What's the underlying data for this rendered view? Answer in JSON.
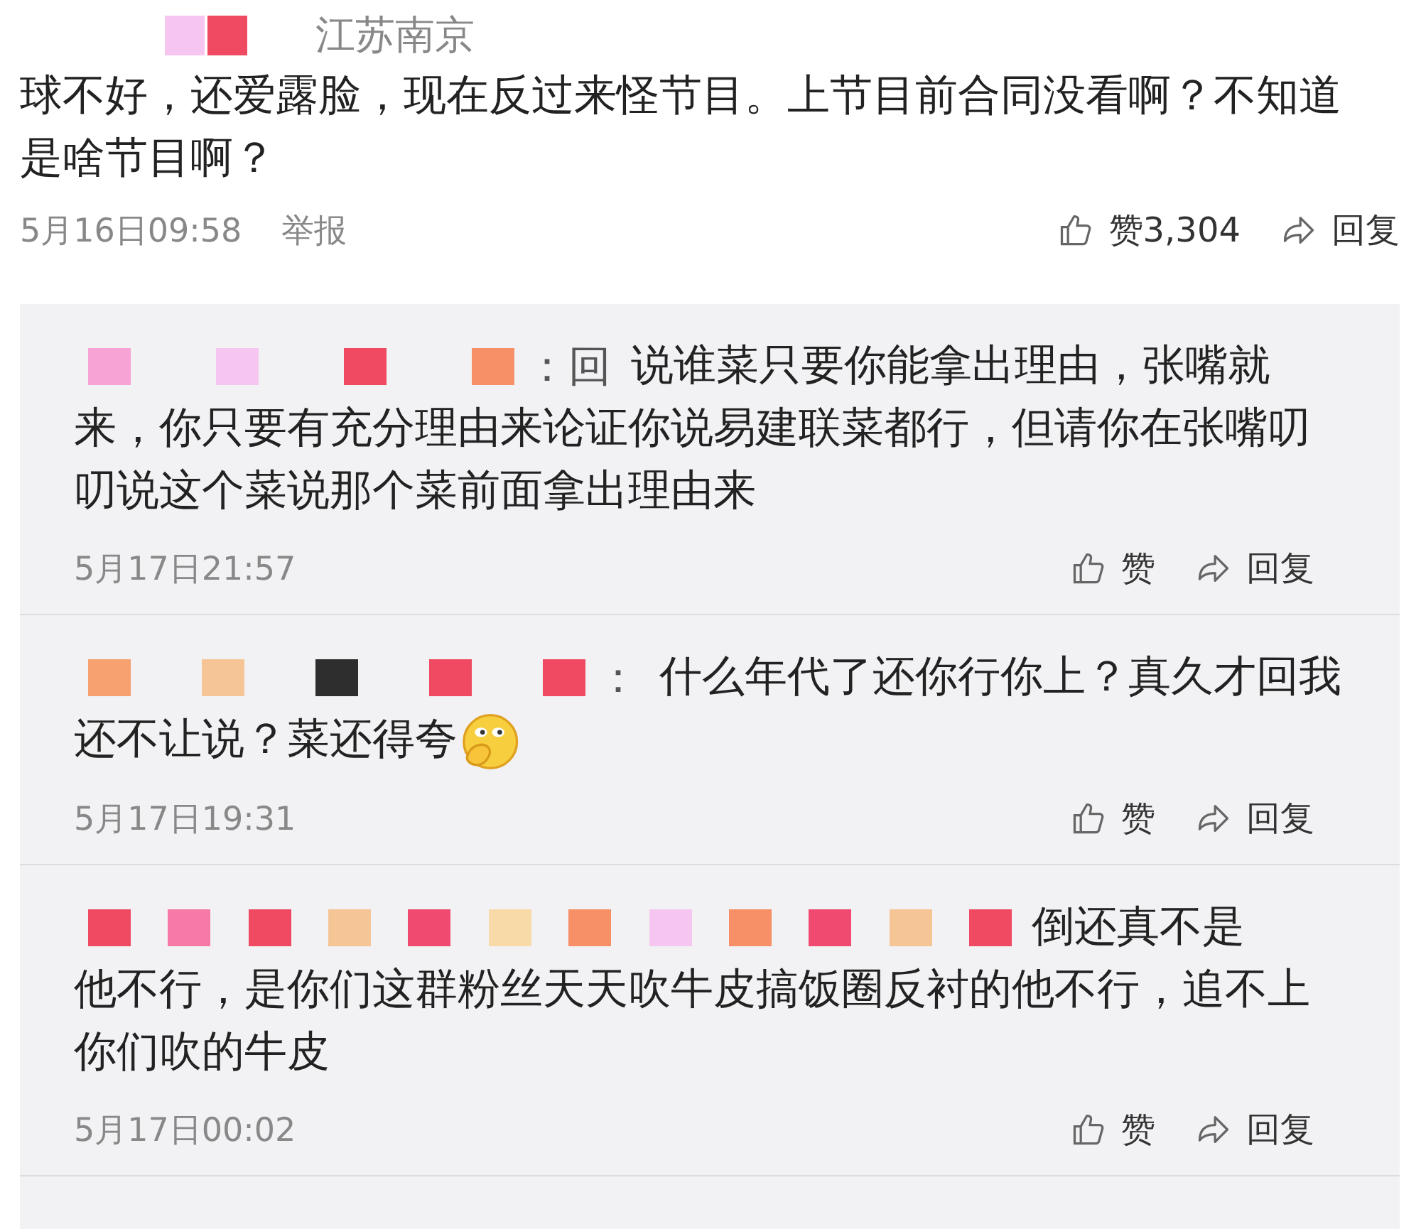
{
  "comment": {
    "mosaic": [
      {
        "color": "#f7c6f0"
      },
      {
        "color": "#f04a63"
      }
    ],
    "location": "江苏南京",
    "text": "球不好，还爱露脸，现在反过来怪节目。上节目前合同没看啊？不知道是啥节目啊？",
    "time": "5月16日09:58",
    "report": "举报",
    "like": "赞3,304",
    "reply": "回复"
  },
  "replies": [
    {
      "mosaic": [
        {
          "color": "#f7a3d6"
        },
        {
          "color": "#f7c6f0"
        },
        {
          "color": "#f04a63"
        },
        {
          "color": "#f79066"
        }
      ],
      "prefix": "：回",
      "lead": "说谁菜只要你能拿出理由，张嘴就",
      "text": "来，你只要有充分理由来论证你说易建联菜都行，但请你在张嘴叨叨说这个菜说那个菜前面拿出理由来",
      "emoji": false,
      "time": "5月17日21:57",
      "like": "赞",
      "reply": "回复"
    },
    {
      "mosaic": [
        {
          "color": "#f7a070"
        },
        {
          "color": "#f5c596"
        },
        {
          "color": "#2e2e2e"
        },
        {
          "color": "#f04a63"
        },
        {
          "color": "#f04a63"
        }
      ],
      "prefix": "：",
      "lead": "什么年代了还你行你上？真久才回我",
      "text": "还不让说？菜还得夸",
      "emoji": true,
      "time": "5月17日19:31",
      "like": "赞",
      "reply": "回复"
    },
    {
      "mosaic": [
        {
          "color": "#f04a63"
        },
        {
          "color": "#f57aa8"
        },
        {
          "color": "#f04a63"
        },
        {
          "color": "#f5c596"
        },
        {
          "color": "#f04a70"
        },
        {
          "color": "#f8d9a8"
        },
        {
          "color": "#f79066"
        },
        {
          "color": "#f7c6f0"
        },
        {
          "color": "#f79066"
        },
        {
          "color": "#f04a70"
        },
        {
          "color": "#f5c596"
        },
        {
          "color": "#f04a63"
        }
      ],
      "lead": "倒还真不是",
      "text": "他不行，是你们这群粉丝天天吹牛皮搞饭圈反衬的他不行，追不上你们吹的牛皮",
      "emoji": false,
      "time": "5月17日00:02",
      "like": "赞",
      "reply": "回复"
    }
  ]
}
